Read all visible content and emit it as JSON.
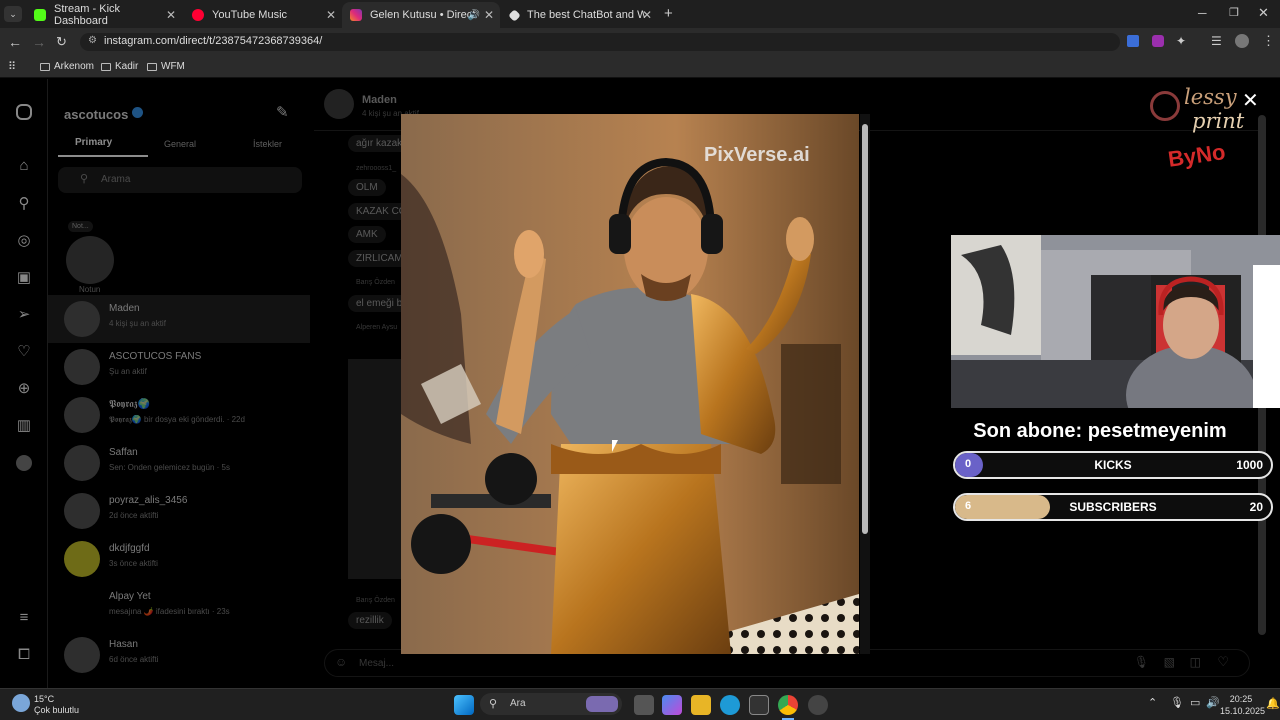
{
  "tabs": [
    {
      "label": "Stream - Kick Dashboard",
      "color": "#53fc18"
    },
    {
      "label": "YouTube Music",
      "color": "#ff0033"
    },
    {
      "label": "Gelen Kutusu • Direct",
      "color": "#d62976"
    },
    {
      "label": "The best ChatBot and Widgets",
      "color": "#cccccc"
    }
  ],
  "address": {
    "url": "instagram.com/direct/t/23875472368739364/"
  },
  "bookmarks": [
    "Arkenom",
    "Kadir",
    "WFM"
  ],
  "sidebar": {
    "username": "ascotucos",
    "tabs": [
      "Primary",
      "General",
      "İstekler"
    ],
    "search_placeholder": "Arama",
    "note_label": "Not...",
    "note_caption": "Notun",
    "conversations": [
      {
        "name": "Maden",
        "sub": "4 kişi şu an aktif"
      },
      {
        "name": "ASCOTUCOS FANS",
        "sub": "Şu an aktif"
      },
      {
        "name": "𝕻𝖔𝖞𝖗𝖆𝖟🌍",
        "sub": "𝕻𝖔𝖞𝖗𝖆𝖟🌍 bir dosya eki gönderdi. · 22d"
      },
      {
        "name": "Saffan",
        "sub": "Sen: Onden gelemicez bugün · 5s"
      },
      {
        "name": "poyraz_alis_3456",
        "sub": "2d önce aktifti"
      },
      {
        "name": "dkdjfggfd",
        "sub": "3s önce aktifti"
      },
      {
        "name": "Alpay Yet",
        "sub": "mesajına 🌶️ ifadesini bıraktı · 23s"
      },
      {
        "name": "Hasan",
        "sub": "6d önce aktifti"
      }
    ]
  },
  "chat": {
    "title": "Maden",
    "subtitle": "4 kişi şu an aktif",
    "messages": [
      "ağır kazak",
      "zehroooss1_",
      "OLM",
      "KAZAK CO",
      "AMK",
      "ZIRLICAM",
      "Barış Özden",
      "el emeği b",
      "Alperen Aysu",
      "Barış Özden",
      "rezillik"
    ],
    "composer_placeholder": "Mesaj..."
  },
  "media": {
    "watermark": "PixVerse.ai"
  },
  "overlay": {
    "logo_lines": [
      "lessy",
      "print",
      "ByNo"
    ],
    "last_sub_text": "Son abone: pesetmeyenim",
    "goals": [
      {
        "current": "0",
        "label": "KICKS",
        "goal": "1000",
        "progress": 0.0,
        "color": "#6a62c8"
      },
      {
        "current": "6",
        "label": "SUBSCRIBERS",
        "goal": "20",
        "progress": 0.3,
        "color": "#d8b98a"
      }
    ]
  },
  "taskbar": {
    "weather_temp": "15°C",
    "weather_desc": "Çok bulutlu",
    "search_label": "Ara",
    "time": "20:25",
    "date": "15.10.2025"
  }
}
